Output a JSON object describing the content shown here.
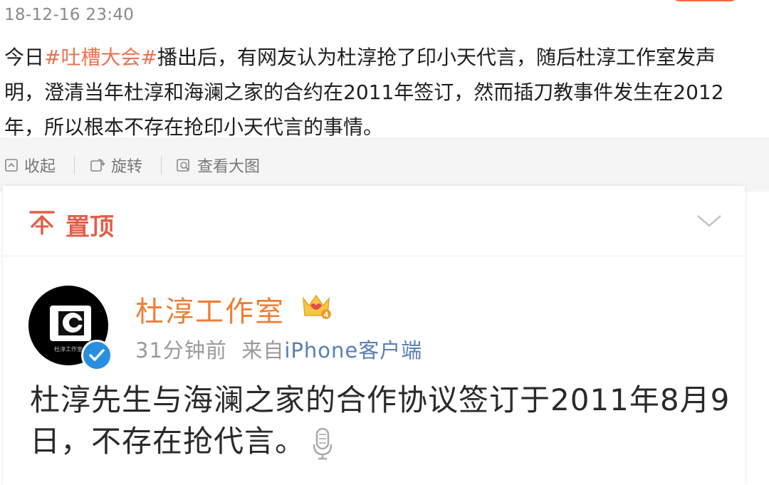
{
  "post": {
    "date": "18-12-16 23:40",
    "text_before_tag": "今日",
    "hashtag": "#吐槽大会#",
    "text_after_tag": "播出后，有网友认为杜淳抢了印小天代言，随后杜淳工作室发声明，澄清当年杜淳和海澜之家的合约在2011年签订，然而插刀教事件发生在2012年，所以根本不存在抢印小天代言的事情。"
  },
  "media_bar": {
    "collapse_label": "收起",
    "rotate_label": "旋转",
    "view_large_label": "查看大图"
  },
  "card": {
    "pin_label": "置顶",
    "username": "杜淳工作室",
    "crown_level": "4",
    "time": "31分钟前",
    "source_prefix": "来自",
    "source": "iPhone客户端",
    "text": "杜淳先生与海澜之家的合作协议签订于2011年8月9日，不存在抢代言。",
    "avatar_caption": "杜淳工作室"
  },
  "colors": {
    "accent": "#eb7350",
    "username": "#ef7e34",
    "pin": "#e1604a",
    "link": "#5a7fb5"
  }
}
